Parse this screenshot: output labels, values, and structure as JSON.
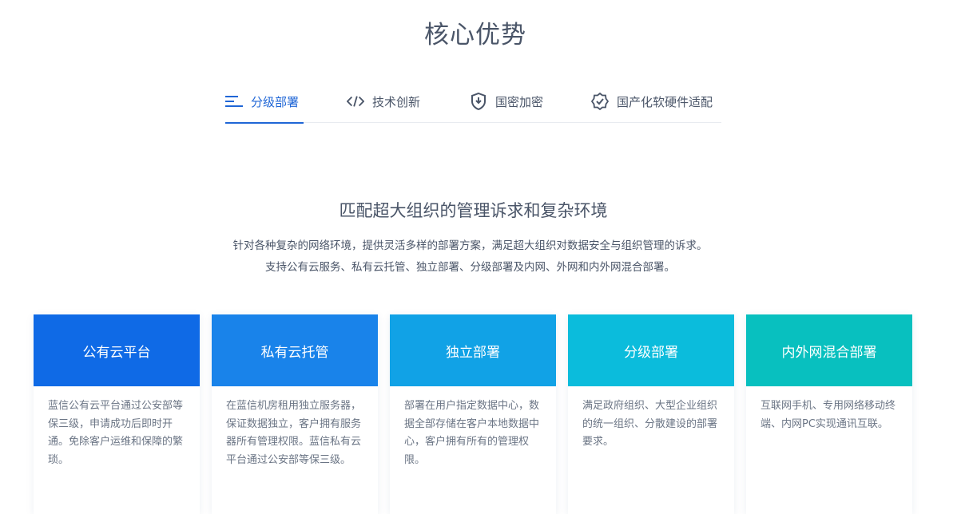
{
  "header": {
    "title": "核心优势"
  },
  "tabs": [
    {
      "label": "分级部署",
      "icon": "list-icon",
      "active": true
    },
    {
      "label": "技术创新",
      "icon": "code-icon",
      "active": false
    },
    {
      "label": "国密加密",
      "icon": "shield-icon",
      "active": false
    },
    {
      "label": "国产化软硬件适配",
      "icon": "badge-check-icon",
      "active": false
    }
  ],
  "content": {
    "title": "匹配超大组织的管理诉求和复杂环境",
    "desc_line1": "针对各种复杂的网络环境，提供灵活多样的部署方案，满足超大组织对数据安全与组织管理的诉求。",
    "desc_line2": "支持公有云服务、私有云托管、独立部署、分级部署及内网、外网和内外网混合部署。"
  },
  "cards": [
    {
      "title": "公有云平台",
      "color": "#0f6ae6",
      "text": "蓝信公有云平台通过公安部等保三级，申请成功后即时开通。免除客户运维和保障的繁琐。"
    },
    {
      "title": "私有云托管",
      "color": "#1983ea",
      "text": "在蓝信机房租用独立服务器，保证数据独立，客户拥有服务器所有管理权限。蓝信私有云平台通过公安部等保三级。"
    },
    {
      "title": "独立部署",
      "color": "#11a2e6",
      "text": "部署在用户指定数据中心，数据全部存储在客户本地数据中心，客户拥有所有的管理权限。"
    },
    {
      "title": "分级部署",
      "color": "#0bbcdc",
      "text": "满足政府组织、大型企业组织的统一组织、分散建设的部署要求。"
    },
    {
      "title": "内外网混合部署",
      "color": "#08c0bf",
      "text": "互联网手机、专用网络移动终端、内网PC实现通讯互联。"
    }
  ],
  "colors": {
    "accent": "#1f66d6",
    "text": "#4a5568",
    "muted": "#6b7585"
  }
}
